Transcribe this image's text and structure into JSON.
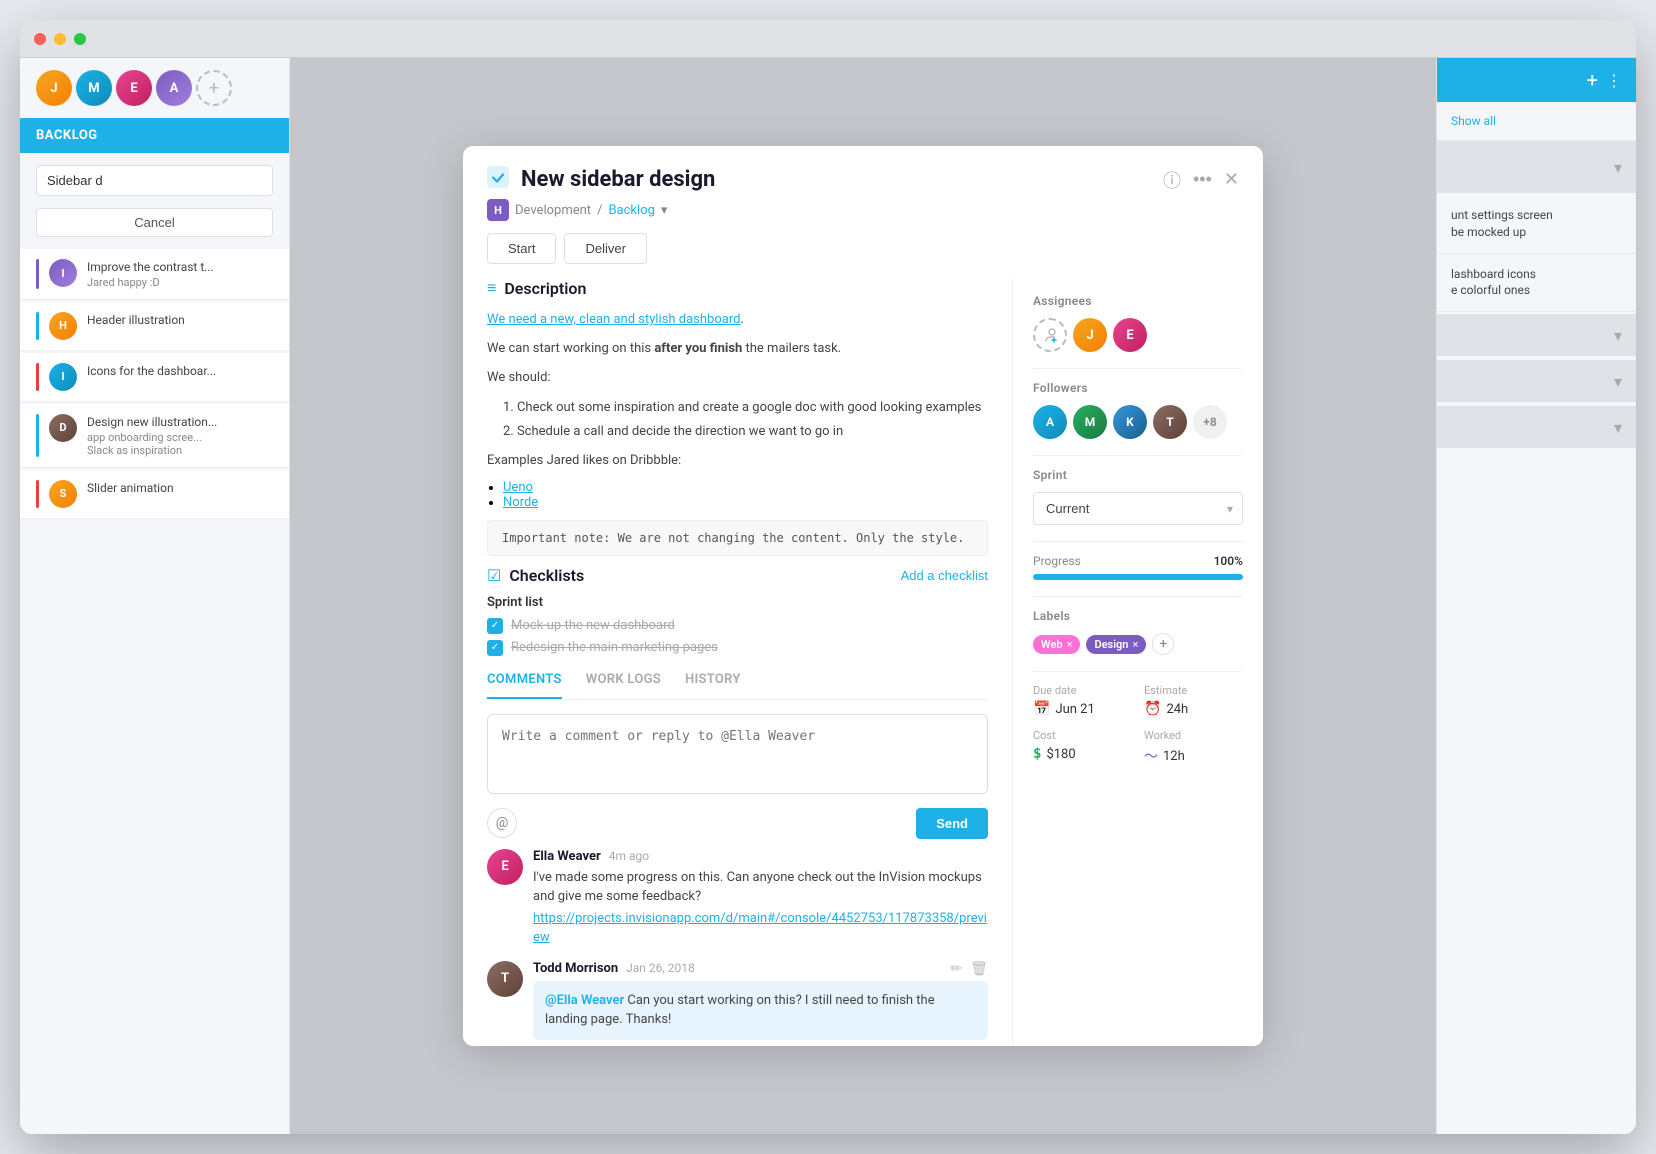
{
  "app": {
    "title": "New sidebar design"
  },
  "macBtns": [
    "red",
    "yellow",
    "green"
  ],
  "breadcrumb": {
    "initial": "H",
    "project": "Development",
    "sprint": "Backlog"
  },
  "toolbar": {
    "start": "Start",
    "deliver": "Deliver"
  },
  "description": {
    "sectionTitle": "Description",
    "line1": "We need a new, clean and stylish dashboard.",
    "line2": "We can start working on this ",
    "boldText": "after you finish",
    "line2end": " the mailers task.",
    "weShould": "We should:",
    "items": [
      "1. Check out some inspiration and create a google doc with good looking examples",
      "2. Schedule a call and decide the direction we want to go in"
    ],
    "examplesLabel": "Examples Jared likes on Dribbble:",
    "bullets": [
      "Ueno",
      "Norde"
    ],
    "codeBlock": "Important note: We are not changing the content. Only the style."
  },
  "checklists": {
    "sectionTitle": "Checklists",
    "addLabel": "Add a checklist",
    "listName": "Sprint list",
    "items": [
      {
        "text": "Mock-up the new dashboard",
        "done": true
      },
      {
        "text": "Redesign the main marketing pages",
        "done": true
      }
    ]
  },
  "tabs": {
    "items": [
      "COMMENTS",
      "WORK LOGS",
      "HISTORY"
    ],
    "activeIndex": 0
  },
  "commentBox": {
    "placeholder": "Write a comment or reply to @Ella Weaver"
  },
  "buttons": {
    "at": "@",
    "send": "Send"
  },
  "comments": [
    {
      "id": "c1",
      "author": "Ella Weaver",
      "time": "4m ago",
      "text": "I've made some progress on this. Can anyone check out the InVision mockups and give me some feedback?",
      "link": "https://projects.invisionapp.com/d/main#/console/4452753/117873358/preview",
      "avatarInitial": "E",
      "avatarClass": "av-pink"
    },
    {
      "id": "c2",
      "author": "Todd Morrison",
      "time": "Jan 26, 2018",
      "mention": "@Ella Weaver",
      "bubbleText": " Can you start working on this? I still need to finish the landing page. Thanks!",
      "avatarInitial": "T",
      "avatarClass": "av-brown"
    }
  ],
  "rightPanel": {
    "assigneesTitle": "Assignees",
    "followersTitle": "Followers",
    "followersCount": "+8",
    "sprintTitle": "Sprint",
    "sprintValue": "Current",
    "progressTitle": "Progress",
    "progressPct": "100%",
    "progressValue": 100,
    "labelsTitle": "Labels",
    "labels": [
      {
        "text": "Web",
        "class": "label-web"
      },
      {
        "text": "Design",
        "class": "label-design"
      }
    ],
    "dueDateTitle": "Due date",
    "dueDateIcon": "📅",
    "dueDateValue": "Jun 21",
    "estimateTitle": "Estimate",
    "estimateIcon": "⏰",
    "estimateValue": "24h",
    "costTitle": "Cost",
    "costIcon": "$",
    "costValue": "$180",
    "workedTitle": "Worked",
    "workedIcon": "〜",
    "workedValue": "12h"
  },
  "sidebar": {
    "backlogLabel": "BACKLOG",
    "searchValue": "Sidebar d",
    "cancelLabel": "Cancel",
    "tasks": [
      {
        "id": "t1",
        "text": "Improve the contrast t...",
        "sub": "Jared happy :D",
        "barColor": "#7c5cbf",
        "avatarClass": "av-purple",
        "initial": "I"
      },
      {
        "id": "t2",
        "text": "Header illustration",
        "sub": "",
        "barColor": "#1db1e8",
        "avatarClass": "av-orange",
        "initial": "H"
      },
      {
        "id": "t3",
        "text": "Icons for the dashboar...",
        "sub": "",
        "barColor": "#e84040",
        "avatarClass": "av-teal",
        "initial": "I"
      },
      {
        "id": "t4",
        "text": "Design new illustration...",
        "sub": "app onboarding scree...\nSlack as inspiration",
        "barColor": "#1db1e8",
        "avatarClass": "av-brown",
        "initial": "D"
      },
      {
        "id": "t5",
        "text": "Slider animation",
        "sub": "",
        "barColor": "#e84040",
        "avatarClass": "av-orange",
        "initial": "S"
      }
    ]
  },
  "rightSidePanel": {
    "showAll": "Show all",
    "items": [
      "unt settings screen\nbe mocked up",
      "lashboard icons\ne colorful ones",
      "",
      "",
      ""
    ]
  }
}
